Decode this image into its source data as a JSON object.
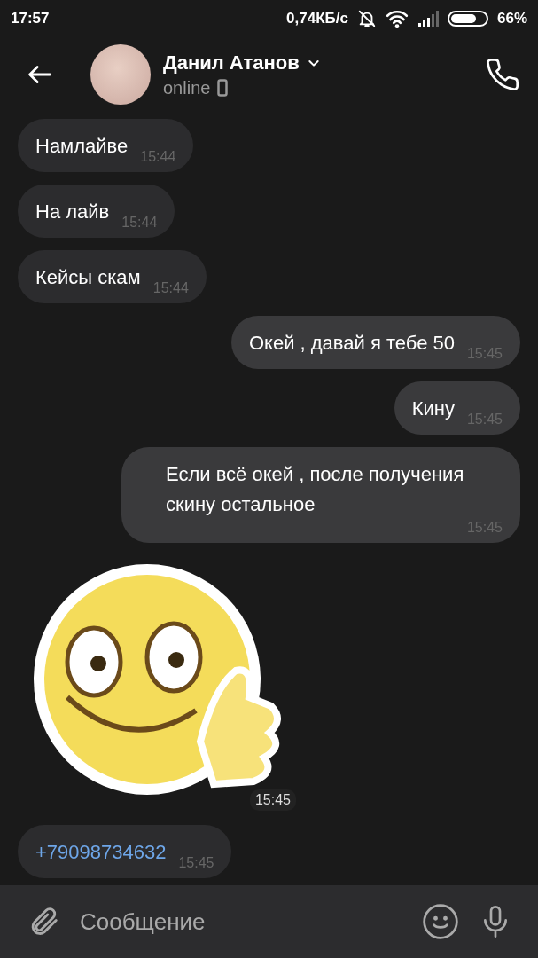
{
  "status_bar": {
    "time": "17:57",
    "speed": "0,74КБ/с",
    "battery": "66%"
  },
  "header": {
    "name": "Данил Атанов",
    "status": "online"
  },
  "messages": [
    {
      "kind": "text",
      "outgoing": false,
      "text": "Намлайве",
      "time": "15:44"
    },
    {
      "kind": "text",
      "outgoing": false,
      "text": "На лайв",
      "time": "15:44"
    },
    {
      "kind": "text",
      "outgoing": false,
      "text": "Кейсы скам",
      "time": "15:44"
    },
    {
      "kind": "text",
      "outgoing": true,
      "text": "Окей , давай я тебе 50",
      "time": "15:45"
    },
    {
      "kind": "text",
      "outgoing": true,
      "text": "Кину",
      "time": "15:45"
    },
    {
      "kind": "text",
      "outgoing": true,
      "text": "Если всё окей , после получения скину остальное",
      "time": "15:45"
    },
    {
      "kind": "sticker",
      "outgoing": false,
      "time": "15:45"
    },
    {
      "kind": "link",
      "outgoing": false,
      "text": "+79098734632",
      "time": "15:45"
    }
  ],
  "composer": {
    "placeholder": "Сообщение"
  }
}
